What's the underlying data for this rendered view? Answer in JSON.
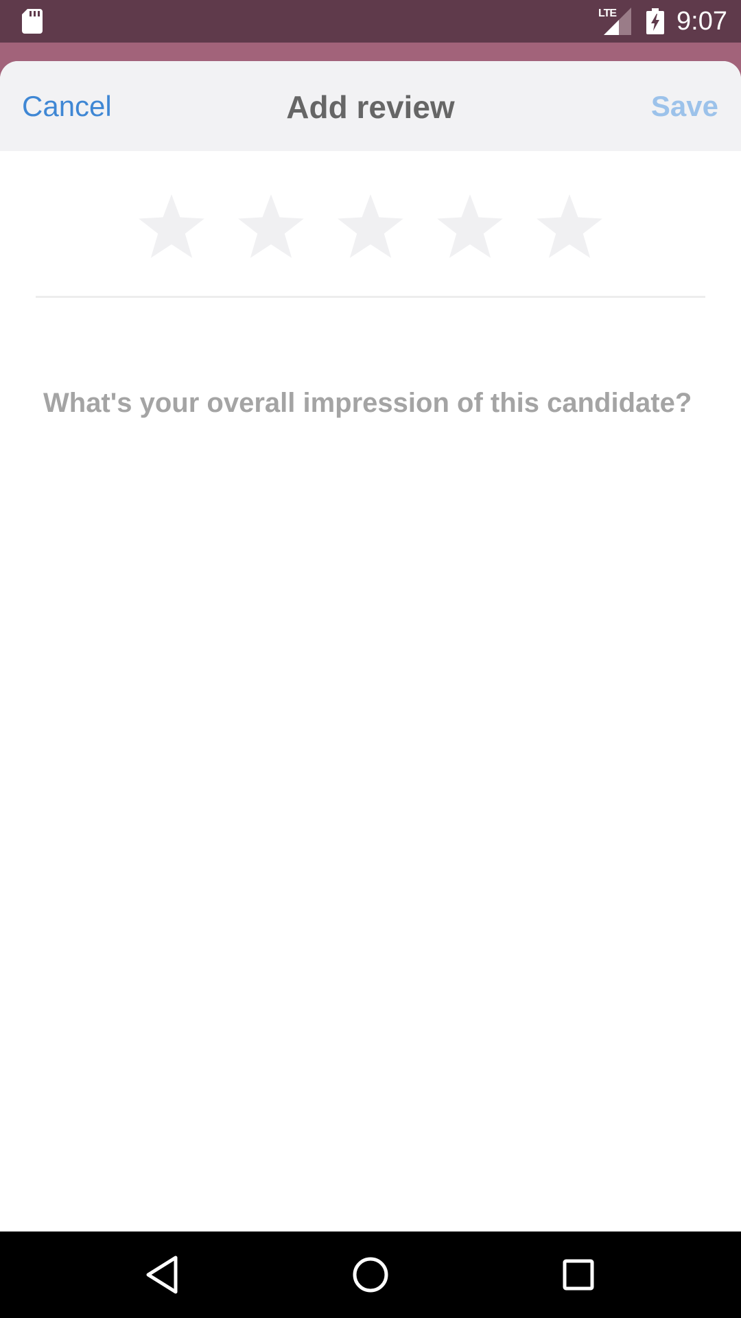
{
  "status_bar": {
    "network_label": "LTE",
    "time": "9:07",
    "icons": [
      "sd-card-icon",
      "signal-icon",
      "battery-charging-icon"
    ]
  },
  "header": {
    "cancel_label": "Cancel",
    "title": "Add review",
    "save_label": "Save"
  },
  "rating": {
    "max_stars": 5,
    "value": 0
  },
  "prompt": {
    "text": "What's your overall impression of this candidate?"
  },
  "nav_bar": {
    "buttons": [
      "back-icon",
      "home-icon",
      "recents-icon"
    ]
  },
  "colors": {
    "status_bar": "#5f3a4b",
    "backdrop": "#a2637a",
    "accent_blue": "#3f87d4",
    "save_disabled": "#9cc2ea",
    "header_bg": "#f2f2f4",
    "star_empty": "#f0f0f2"
  }
}
